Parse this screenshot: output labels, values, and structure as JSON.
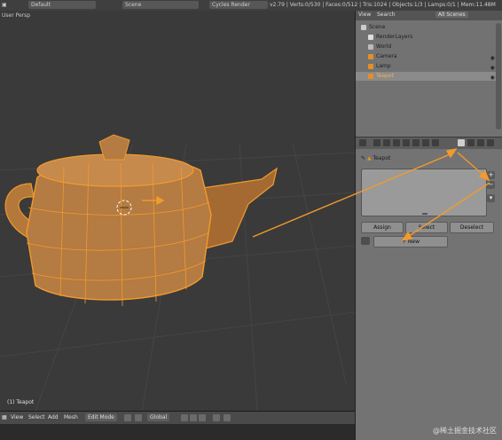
{
  "topbar": {
    "items": [
      "Default",
      "Scene",
      "Cycles Render"
    ],
    "stats": "v2.79 | Verts:0/530 | Faces:0/512 | Tris:1024 | Objects:1/3 | Lamps:0/1 | Mem:11.48M"
  },
  "viewport": {
    "label": "User Persp",
    "object_label": "(1) Teapot"
  },
  "bottom_bar": {
    "view": "View",
    "select": "Select",
    "add": "Add",
    "mesh": "Mesh",
    "mode": "Edit Mode",
    "pivot": "Global"
  },
  "outliner": {
    "header_view": "View",
    "header_search": "Search",
    "header_scope": "All Scenes",
    "items": [
      {
        "label": "Scene"
      },
      {
        "label": "RenderLayers"
      },
      {
        "label": "World"
      },
      {
        "label": "Camera"
      },
      {
        "label": "Lamp"
      },
      {
        "label": "Teapot"
      }
    ]
  },
  "properties": {
    "breadcrumb_object": "Teapot",
    "assign_label": "Assign",
    "select_label": "Select",
    "deselect_label": "Deselect",
    "new_label": "New",
    "add_slot": "+",
    "remove_slot": "−"
  },
  "colors": {
    "accent": "#e39028",
    "viewport_bg": "#3a3a3a",
    "panel_bg": "#737373"
  },
  "watermark": "@稀土掘金技术社区"
}
